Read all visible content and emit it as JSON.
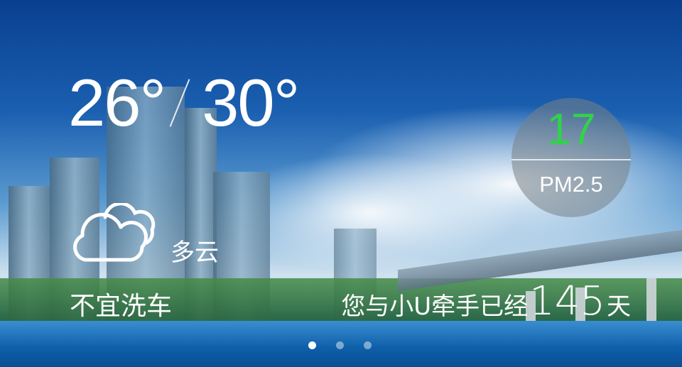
{
  "weather": {
    "temp_low": "26°",
    "temp_high": "30°",
    "condition": "多云",
    "condition_icon": "cloud-icon",
    "advice": "不宜洗车"
  },
  "air_quality": {
    "pm25_value": "17",
    "pm25_label": "PM2.5",
    "value_color": "#2fd34a"
  },
  "companion": {
    "prefix": "您与小U牵手已经",
    "days": "145",
    "suffix": "天"
  },
  "pager": {
    "total": 3,
    "active_index": 0
  }
}
